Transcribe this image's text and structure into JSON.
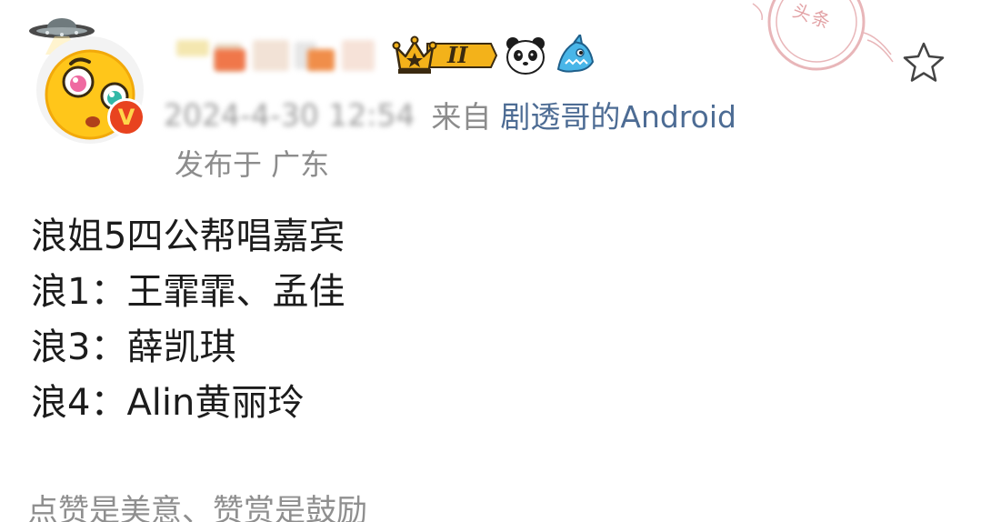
{
  "post": {
    "meta": {
      "time": "2024-4-30 12:54",
      "from_label": "来自",
      "source": "剧透哥的Android",
      "location": "发布于 广东"
    },
    "badges": {
      "vip_level": "II"
    },
    "lines": [
      "浪姐5四公帮唱嘉宾",
      "浪1：王霏霏、孟佳",
      "浪3：薛凯琪",
      "浪4：Alin黄丽玲"
    ],
    "footer": "点赞是美意、赞赏是鼓励"
  },
  "stamp": {
    "text": "头条"
  },
  "icons": {
    "star": "star-outline-icon",
    "avatar": "avatar-emoji-icon",
    "verified": "verified-v-icon",
    "ufo": "ufo-pendant-icon",
    "crown": "crown-vip-icon",
    "panda": "panda-icon",
    "shark": "shark-icon"
  },
  "colors": {
    "source_link": "#4d6c94",
    "meta_text": "#8c8c8c",
    "body_text": "#1c1c1c",
    "verified_badge": "#e8431f",
    "vip_gold": "#f3b21a",
    "stamp": "#d77c80"
  }
}
